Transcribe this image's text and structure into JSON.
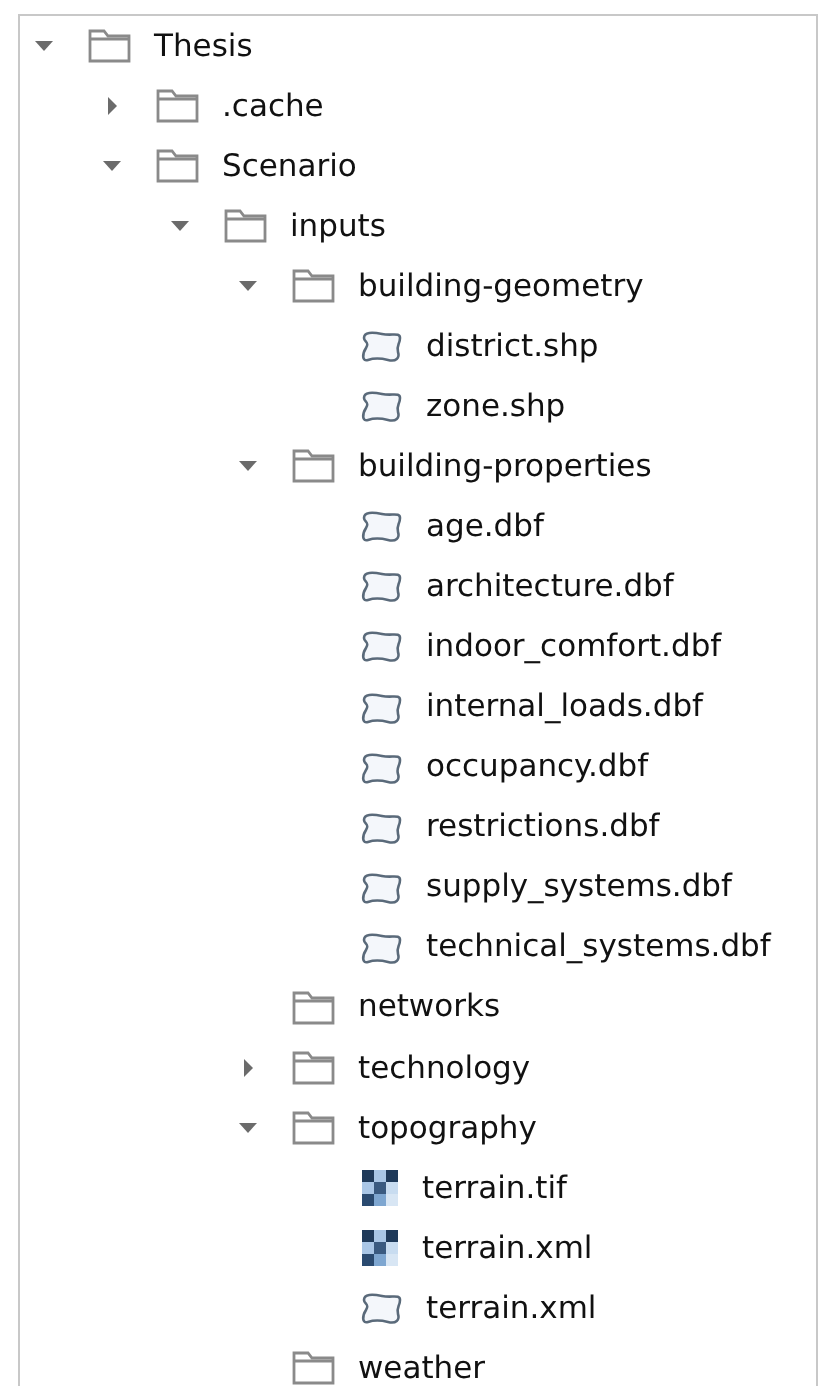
{
  "tree": [
    {
      "label": "Thesis",
      "kind": "folder",
      "expanded": true,
      "children": [
        {
          "label": ".cache",
          "kind": "folder",
          "expanded": false
        },
        {
          "label": "Scenario",
          "kind": "folder",
          "expanded": true,
          "children": [
            {
              "label": "inputs",
              "kind": "folder",
              "expanded": true,
              "children": [
                {
                  "label": "building-geometry",
                  "kind": "folder",
                  "expanded": true,
                  "children": [
                    {
                      "label": "district.shp",
                      "kind": "vector"
                    },
                    {
                      "label": "zone.shp",
                      "kind": "vector"
                    }
                  ]
                },
                {
                  "label": "building-properties",
                  "kind": "folder",
                  "expanded": true,
                  "children": [
                    {
                      "label": "age.dbf",
                      "kind": "vector"
                    },
                    {
                      "label": "architecture.dbf",
                      "kind": "vector"
                    },
                    {
                      "label": "indoor_comfort.dbf",
                      "kind": "vector"
                    },
                    {
                      "label": "internal_loads.dbf",
                      "kind": "vector"
                    },
                    {
                      "label": "occupancy.dbf",
                      "kind": "vector"
                    },
                    {
                      "label": "restrictions.dbf",
                      "kind": "vector"
                    },
                    {
                      "label": "supply_systems.dbf",
                      "kind": "vector"
                    },
                    {
                      "label": "technical_systems.dbf",
                      "kind": "vector"
                    }
                  ]
                },
                {
                  "label": "networks",
                  "kind": "folder"
                },
                {
                  "label": "technology",
                  "kind": "folder",
                  "expanded": false
                },
                {
                  "label": "topography",
                  "kind": "folder",
                  "expanded": true,
                  "children": [
                    {
                      "label": "terrain.tif",
                      "kind": "raster"
                    },
                    {
                      "label": "terrain.xml",
                      "kind": "raster"
                    },
                    {
                      "label": "terrain.xml",
                      "kind": "vector"
                    }
                  ]
                },
                {
                  "label": "weather",
                  "kind": "folder"
                }
              ]
            }
          ]
        }
      ]
    }
  ]
}
